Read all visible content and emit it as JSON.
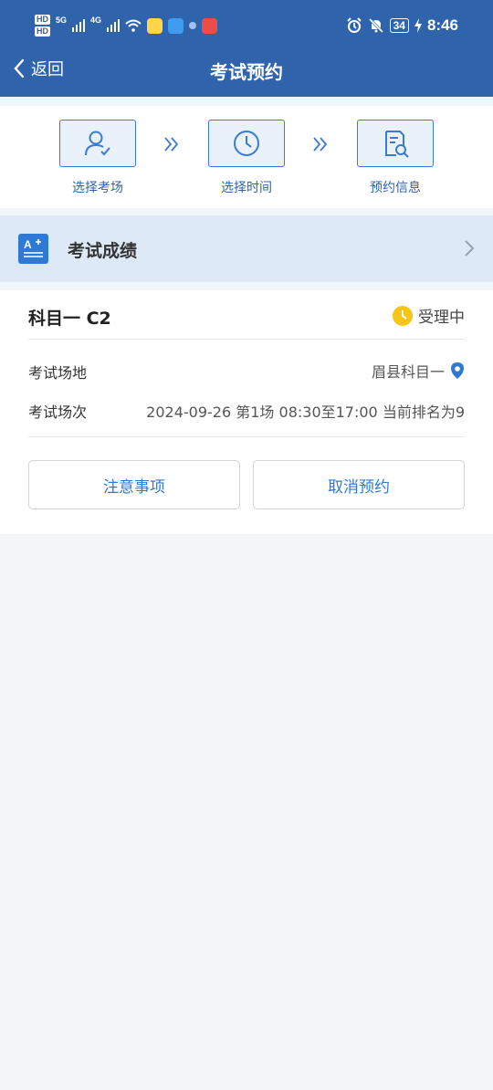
{
  "status_bar": {
    "hd1": "HD",
    "hd2": "HD",
    "net1": "5G",
    "net2": "4G",
    "battery": "34",
    "time": "8:46"
  },
  "nav": {
    "back_label": "返回",
    "title": "考试预约"
  },
  "steps": [
    {
      "label": "选择考场",
      "icon": "person-check-icon"
    },
    {
      "label": "选择时间",
      "icon": "clock-icon"
    },
    {
      "label": "预约信息",
      "icon": "document-search-icon"
    }
  ],
  "score_entry": {
    "label": "考试成绩",
    "icon": "grade-icon"
  },
  "exam": {
    "subject": "科目一 C2",
    "status": "受理中",
    "venue_label": "考试场地",
    "venue_value": "眉县科目一",
    "session_label": "考试场次",
    "session_value": "2024-09-26 第1场 08:30至17:00 当前排名为9"
  },
  "actions": {
    "notes_label": "注意事项",
    "cancel_label": "取消预约"
  },
  "colors": {
    "header_bg": "#2f64ad",
    "accent": "#2f7ad0",
    "status_icon": "#f5c518"
  }
}
